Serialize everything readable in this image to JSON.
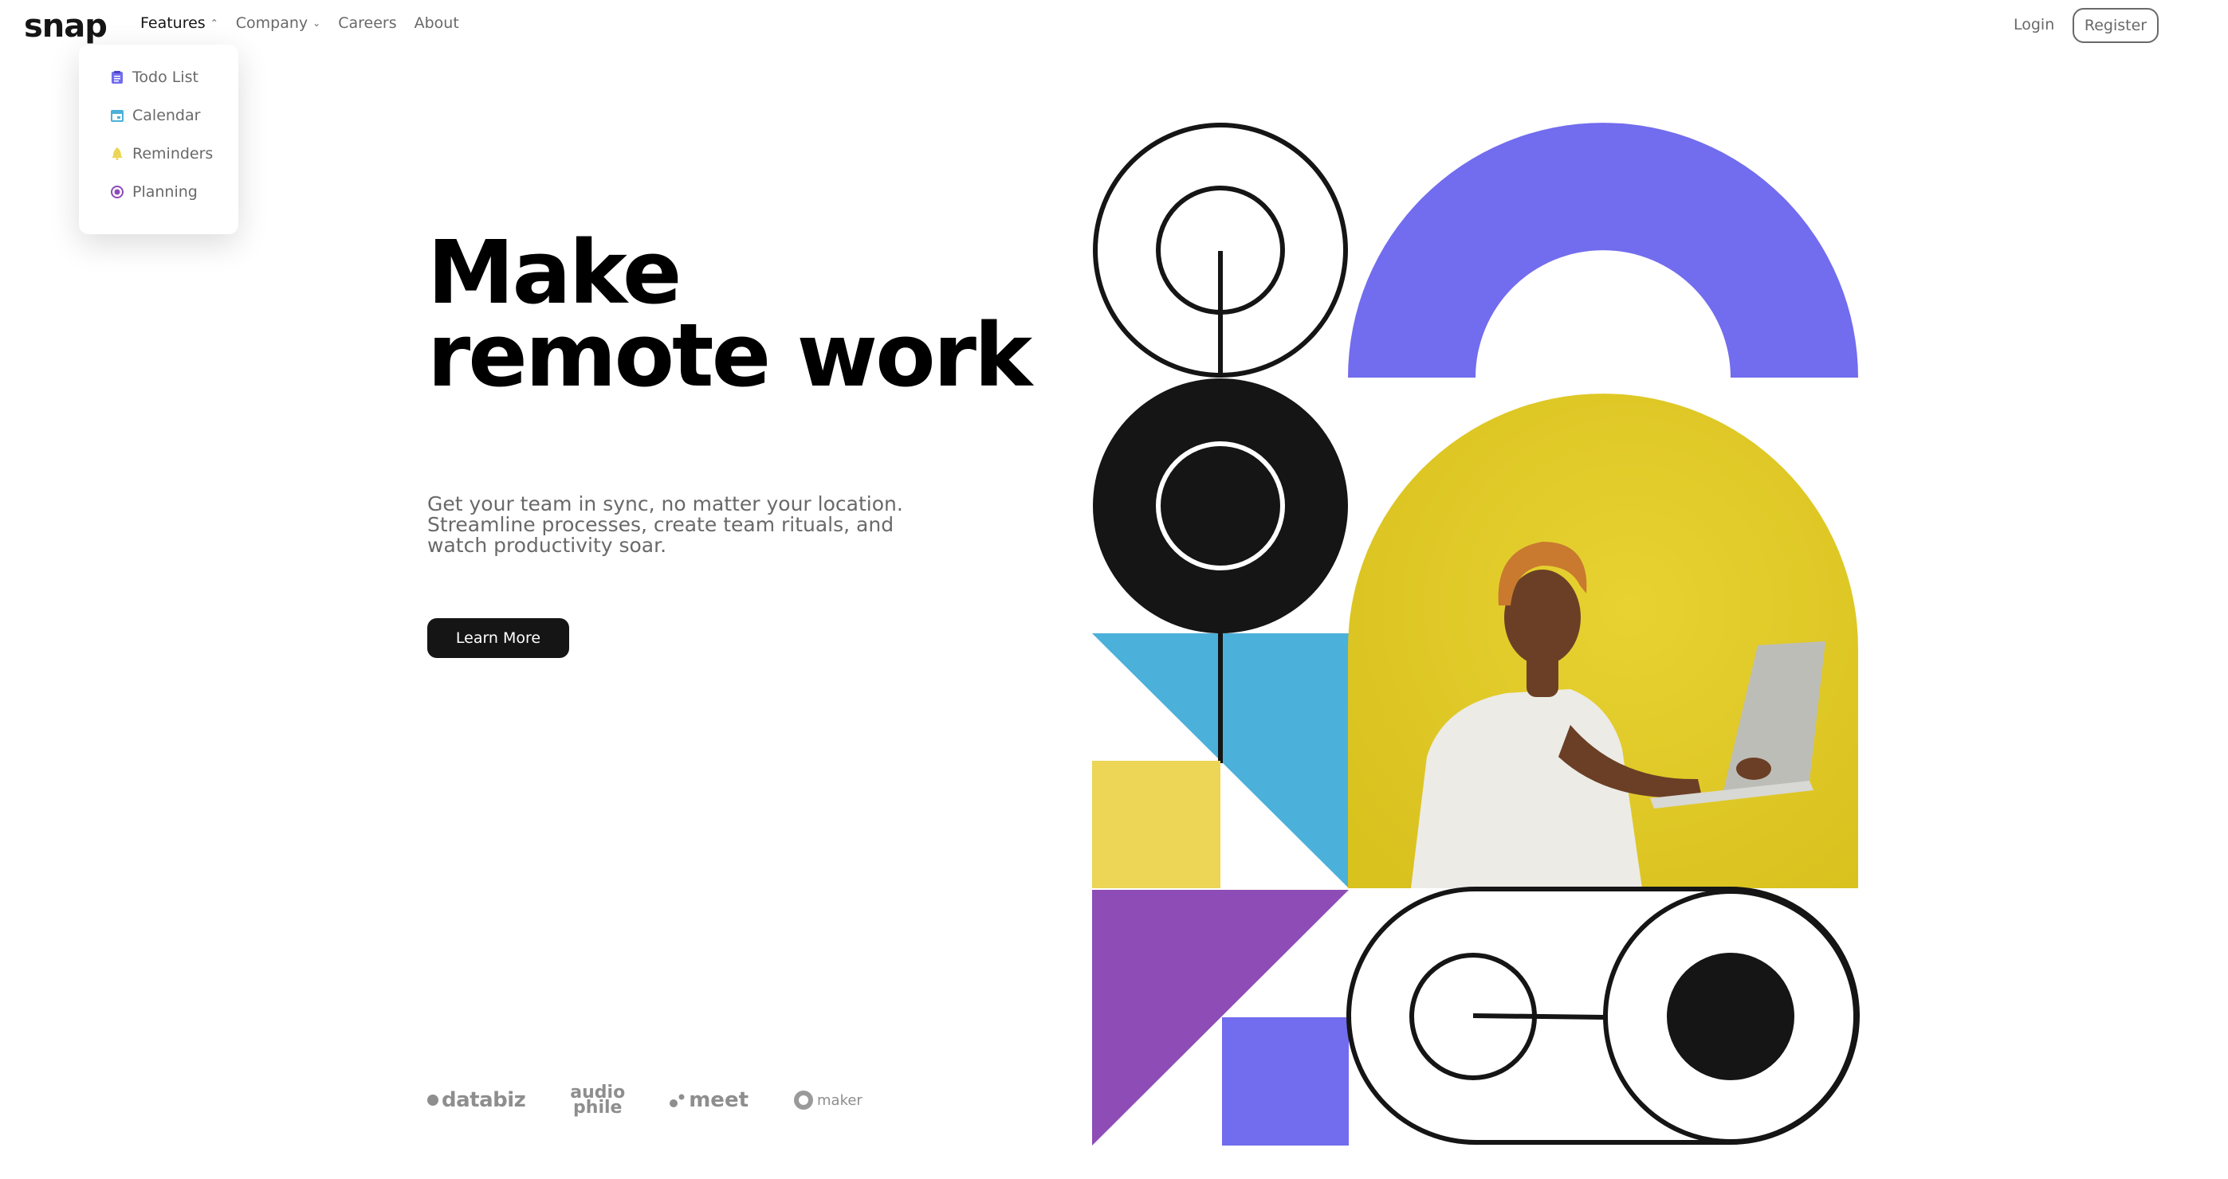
{
  "brand": {
    "logo": "snap"
  },
  "nav": {
    "features": "Features",
    "company": "Company",
    "careers": "Careers",
    "about": "About"
  },
  "features_menu": {
    "items": [
      {
        "label": "Todo List",
        "icon": "todo-icon",
        "color": "#726CEE"
      },
      {
        "label": "Calendar",
        "icon": "calendar-icon",
        "color": "#4BB1DA"
      },
      {
        "label": "Reminders",
        "icon": "reminders-icon",
        "color": "#EDD556"
      },
      {
        "label": "Planning",
        "icon": "planning-icon",
        "color": "#8E4CB6"
      }
    ]
  },
  "auth": {
    "login": "Login",
    "register": "Register"
  },
  "hero": {
    "title_line1": "Make",
    "title_line2": "remote work",
    "description": "Get your team in sync, no matter your location. Streamline processes, create team rituals, and watch productivity soar.",
    "cta": "Learn More"
  },
  "clients": {
    "databiz": "databiz",
    "audiophile_top": "audio",
    "audiophile_bottom": "phile",
    "meet": "meet",
    "maker": "maker"
  },
  "colors": {
    "ink": "#151515",
    "muted": "#696969",
    "purple": "#726CEE",
    "violet": "#8E4CB6",
    "blue": "#4BB1DA",
    "yellow": "#EDD556",
    "photo_yellow": "#E3CD2C"
  }
}
